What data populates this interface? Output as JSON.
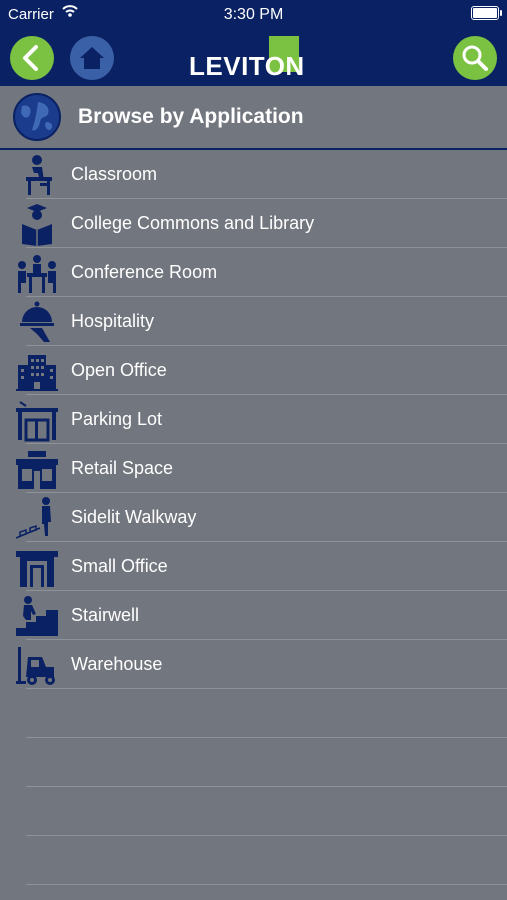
{
  "status": {
    "carrier": "Carrier",
    "time": "3:30 PM",
    "battery_level": 1.0
  },
  "nav": {
    "back_icon": "chevron-left-icon",
    "home_icon": "home-icon",
    "search_icon": "search-icon",
    "brand": "LEVITON"
  },
  "colors": {
    "navy": "#0a2163",
    "green": "#7cc242",
    "blue": "#3a61a7",
    "gray": "#72767e"
  },
  "section": {
    "title": "Browse by Application",
    "icon": "globe-icon"
  },
  "items": [
    {
      "label": "Classroom",
      "icon": "classroom-icon"
    },
    {
      "label": "College Commons and Library",
      "icon": "graduate-reading-icon"
    },
    {
      "label": "Conference Room",
      "icon": "conference-icon"
    },
    {
      "label": "Hospitality",
      "icon": "hospitality-icon"
    },
    {
      "label": "Open Office",
      "icon": "office-building-icon"
    },
    {
      "label": "Parking Lot",
      "icon": "parking-lot-icon"
    },
    {
      "label": "Retail Space",
      "icon": "storefront-icon"
    },
    {
      "label": "Sidelit Walkway",
      "icon": "walkway-icon"
    },
    {
      "label": "Small Office",
      "icon": "small-office-icon"
    },
    {
      "label": "Stairwell",
      "icon": "stairwell-icon"
    },
    {
      "label": "Warehouse",
      "icon": "forklift-icon"
    }
  ]
}
